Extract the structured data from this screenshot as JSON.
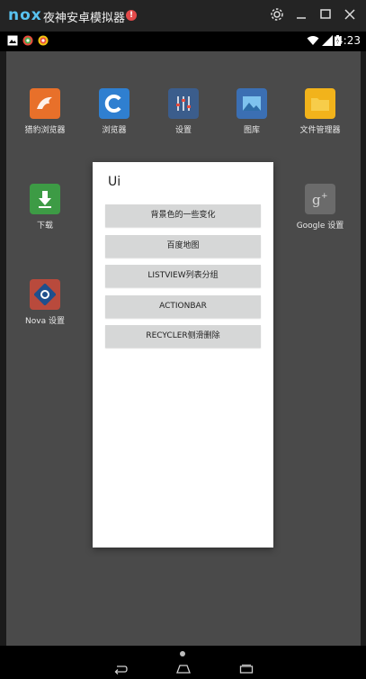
{
  "titlebar": {
    "logo": "nox",
    "title": "夜神安卓模拟器",
    "alert": "!",
    "buttons": [
      "gear-icon",
      "minimize-icon",
      "maximize-icon",
      "close-icon"
    ]
  },
  "statusbar": {
    "time": "4:23"
  },
  "apps": [
    {
      "label": "猎豹浏览器",
      "icon": "cheetah-browser-icon",
      "color": "#e8702a"
    },
    {
      "label": "浏览器",
      "icon": "browser-icon",
      "color": "#2f7fd0"
    },
    {
      "label": "设置",
      "icon": "settings-icon",
      "color": "#3b5d8c"
    },
    {
      "label": "图库",
      "icon": "gallery-icon",
      "color": "#3b6fb3"
    },
    {
      "label": "文件管理器",
      "icon": "file-manager-icon",
      "color": "#f2b31b"
    },
    {
      "label": "下载",
      "icon": "download-icon",
      "color": "#3d9b45"
    },
    {
      "label": "Google 设置",
      "icon": "google-settings-icon",
      "color": "#6b6b6b"
    },
    {
      "label": "Nova 设置",
      "icon": "nova-settings-icon",
      "color": "#b94a3c"
    }
  ],
  "dialog": {
    "title": "Ui",
    "buttons": [
      "背景色的一些变化",
      "百度地图",
      "LISTVIEW列表分组",
      "ACTIONBAR",
      "RECYCLER侧滑删除"
    ]
  }
}
